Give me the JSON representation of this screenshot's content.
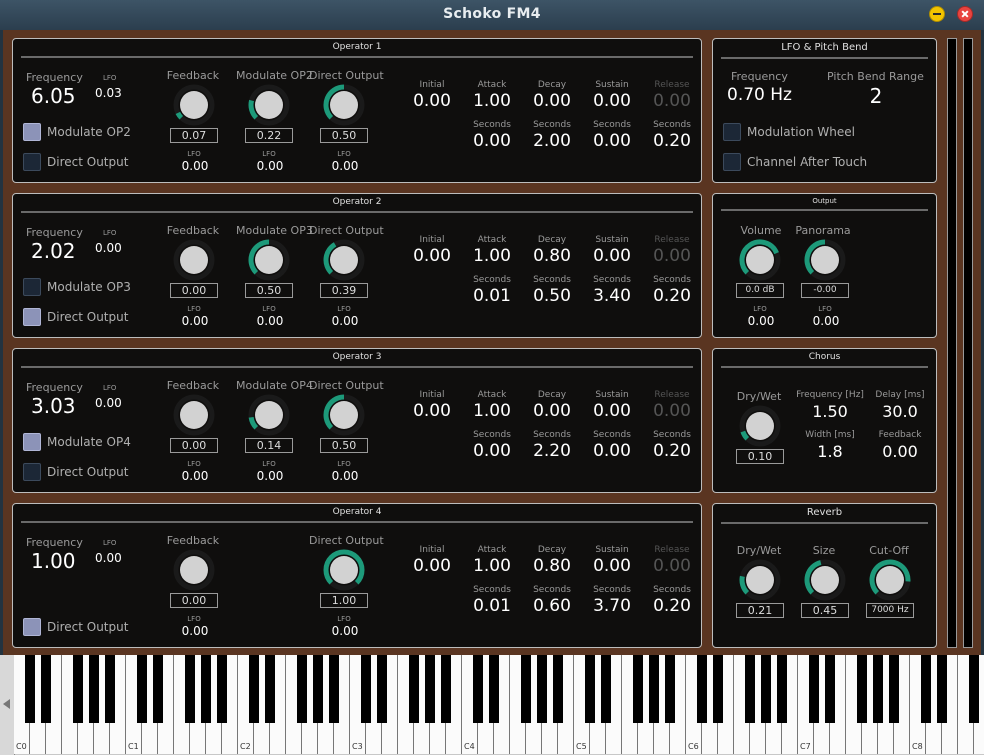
{
  "window": {
    "title": "Schoko FM4",
    "min_icon": "minimize-icon",
    "close_icon": "close-icon"
  },
  "colors": {
    "accent": "#1d9a7a",
    "background": "#5a3521",
    "panel": "#0f0e0d",
    "checkbox_on": "#8c93b8"
  },
  "labels": {
    "frequency": "Frequency",
    "lfo": "LFO",
    "feedback": "Feedback",
    "direct_output": "Direct Output",
    "initial": "Initial",
    "attack": "Attack",
    "decay": "Decay",
    "sustain": "Sustain",
    "release": "Release",
    "seconds": "Seconds"
  },
  "operators": [
    {
      "title": "Operator 1",
      "frequency": "6.05",
      "freq_lfo": "0.03",
      "modulate_label": "Modulate OP2",
      "modulate_checked": true,
      "direct_checked": false,
      "feedback": "0.07",
      "feedback_lfo": "0.00",
      "feedback_level": 0.07,
      "modulate": "0.22",
      "modulate_lfo": "0.00",
      "modulate_level": 0.22,
      "direct": "0.50",
      "direct_lfo": "0.00",
      "direct_level": 0.5,
      "initial": "0.00",
      "attack": "1.00",
      "decay": "0.00",
      "sustain": "0.00",
      "release": "0.00",
      "attack_s": "0.00",
      "decay_s": "2.00",
      "sustain_s": "0.00",
      "release_s": "0.20"
    },
    {
      "title": "Operator 2",
      "frequency": "2.02",
      "freq_lfo": "0.00",
      "modulate_label": "Modulate OP3",
      "modulate_checked": false,
      "direct_checked": true,
      "feedback": "0.00",
      "feedback_lfo": "0.00",
      "feedback_level": 0,
      "modulate": "0.50",
      "modulate_lfo": "0.00",
      "modulate_level": 0.5,
      "direct": "0.39",
      "direct_lfo": "0.00",
      "direct_level": 0.39,
      "initial": "0.00",
      "attack": "1.00",
      "decay": "0.80",
      "sustain": "0.00",
      "release": "0.00",
      "attack_s": "0.01",
      "decay_s": "0.50",
      "sustain_s": "3.40",
      "release_s": "0.20"
    },
    {
      "title": "Operator 3",
      "frequency": "3.03",
      "freq_lfo": "0.00",
      "modulate_label": "Modulate OP4",
      "modulate_checked": true,
      "direct_checked": false,
      "feedback": "0.00",
      "feedback_lfo": "0.00",
      "feedback_level": 0,
      "modulate": "0.14",
      "modulate_lfo": "0.00",
      "modulate_level": 0.14,
      "direct": "0.50",
      "direct_lfo": "0.00",
      "direct_level": 0.5,
      "initial": "0.00",
      "attack": "1.00",
      "decay": "0.00",
      "sustain": "0.00",
      "release": "0.00",
      "attack_s": "0.00",
      "decay_s": "2.20",
      "sustain_s": "0.00",
      "release_s": "0.20"
    },
    {
      "title": "Operator 4",
      "frequency": "1.00",
      "freq_lfo": "0.00",
      "direct_checked": true,
      "feedback": "0.00",
      "feedback_lfo": "0.00",
      "feedback_level": 0,
      "direct": "1.00",
      "direct_lfo": "0.00",
      "direct_level": 1.0,
      "initial": "0.00",
      "attack": "1.00",
      "decay": "0.80",
      "sustain": "0.00",
      "release": "0.00",
      "attack_s": "0.01",
      "decay_s": "0.60",
      "sustain_s": "3.70",
      "release_s": "0.20"
    }
  ],
  "lfo_panel": {
    "title": "LFO & Pitch Bend",
    "frequency_label": "Frequency",
    "frequency": "0.70 Hz",
    "pitch_bend_label": "Pitch Bend Range",
    "pitch_bend": "2",
    "mod_wheel_label": "Modulation Wheel",
    "mod_wheel_checked": false,
    "aftertouch_label": "Channel After Touch",
    "aftertouch_checked": false
  },
  "output_panel": {
    "title": "Output",
    "volume_label": "Volume",
    "volume": "0.0 dB",
    "volume_lfo": "0.00",
    "volume_level": 0.75,
    "panorama_label": "Panorama",
    "panorama": "-0.00",
    "panorama_lfo": "0.00",
    "panorama_level": 0.5,
    "lfo_label": "LFO"
  },
  "chorus_panel": {
    "title": "Chorus",
    "drywet_label": "Dry/Wet",
    "drywet": "0.10",
    "drywet_level": 0.1,
    "frequency_label": "Frequency [Hz]",
    "frequency": "1.50",
    "delay_label": "Delay [ms]",
    "delay": "30.0",
    "width_label": "Width [ms]",
    "width": "1.8",
    "feedback_label": "Feedback",
    "feedback": "0.00"
  },
  "reverb_panel": {
    "title": "Reverb",
    "drywet_label": "Dry/Wet",
    "drywet": "0.21",
    "drywet_level": 0.21,
    "size_label": "Size",
    "size": "0.45",
    "size_level": 0.45,
    "cutoff_label": "Cut-Off",
    "cutoff": "7000 Hz",
    "cutoff_level": 0.85
  },
  "keyboard": {
    "octave_labels": [
      "C0",
      "C1",
      "C2",
      "C3",
      "C4",
      "C5",
      "C6",
      "C7",
      "C8"
    ]
  }
}
